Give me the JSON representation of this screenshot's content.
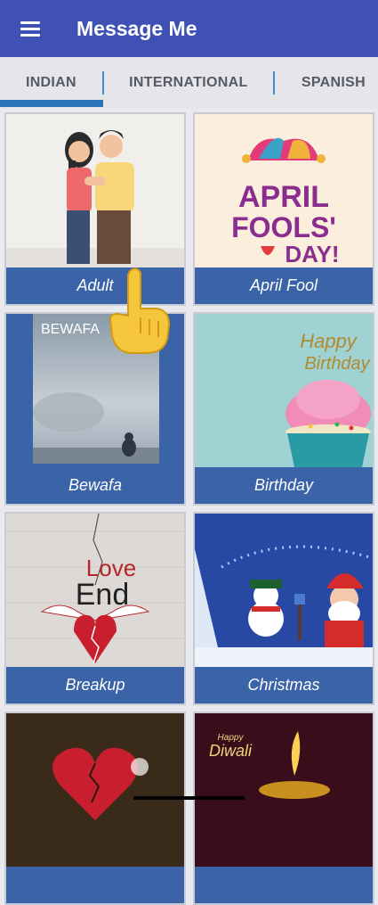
{
  "app": {
    "title": "Message Me"
  },
  "tabs": [
    {
      "label": "INDIAN",
      "selected": true
    },
    {
      "label": "INTERNATIONAL",
      "selected": false
    },
    {
      "label": "SPANISH",
      "selected": false
    }
  ],
  "categories": [
    {
      "label": "Adult"
    },
    {
      "label": "April Fool"
    },
    {
      "label": "Bewafa"
    },
    {
      "label": "Birthday"
    },
    {
      "label": "Breakup"
    },
    {
      "label": "Christmas"
    },
    {
      "label": ""
    },
    {
      "label": ""
    }
  ],
  "thumb_text": {
    "april": [
      "APRIL",
      "FOOLS'",
      "DAY!"
    ],
    "bewafa": "BEWAFA",
    "birthday": [
      "Happy",
      "Birthday"
    ],
    "breakup": [
      "Love",
      "End"
    ],
    "diwali": [
      "Happy",
      "Diwali"
    ]
  },
  "colors": {
    "appbar": "#3f51b5",
    "card_label_bg": "#3b63a7",
    "tab_indicator": "#2a74b8"
  }
}
